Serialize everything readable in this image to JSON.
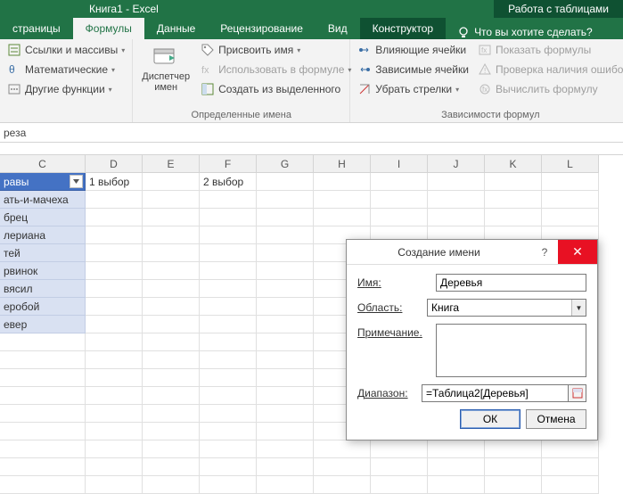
{
  "titlebar": {
    "title": "Книга1 - Excel",
    "context_title": "Работа с таблицами"
  },
  "tabs": {
    "items": [
      "страницы",
      "Формулы",
      "Данные",
      "Рецензирование",
      "Вид"
    ],
    "active_index": 1,
    "context": "Конструктор",
    "tell_me": "Что вы хотите сделать?"
  },
  "ribbon": {
    "group1": {
      "btn1": "Ссылки и массивы",
      "btn2": "Математические",
      "btn3": "Другие функции"
    },
    "group2": {
      "big": "Диспетчер имен",
      "btn1": "Присвоить имя",
      "btn2": "Использовать в формуле",
      "btn3": "Создать из выделенного",
      "label": "Определенные имена"
    },
    "group3": {
      "btn1": "Влияющие ячейки",
      "btn2": "Зависимые ячейки",
      "btn3": "Убрать стрелки",
      "btn4": "Показать формулы",
      "btn5": "Проверка наличия ошибо",
      "btn6": "Вычислить формулу",
      "label": "Зависимости формул"
    }
  },
  "namebox": "реза",
  "columns": [
    "C",
    "D",
    "E",
    "F",
    "G",
    "H",
    "I",
    "J",
    "K",
    "L"
  ],
  "header": {
    "c": "равы",
    "d": "1 выбор",
    "f": "2 выбор"
  },
  "tableC": [
    "ать-и-мачеха",
    "брец",
    "лериана",
    "тей",
    "рвинок",
    "вясил",
    "еробой",
    "евер"
  ],
  "dialog": {
    "title": "Создание имени",
    "lbl_name": "Имя:",
    "lbl_name_u": "И",
    "lbl_scope": "Область:",
    "lbl_scope_u": "О",
    "lbl_comment": "Примечание.",
    "lbl_comment_u": "П",
    "lbl_range": "Диапазон:",
    "lbl_range_u": "Д",
    "name_value": "Деревья",
    "scope_value": "Книга",
    "comment_value": "",
    "range_value": "=Таблица2[Деревья]",
    "ok": "ОК",
    "cancel": "Отмена"
  }
}
